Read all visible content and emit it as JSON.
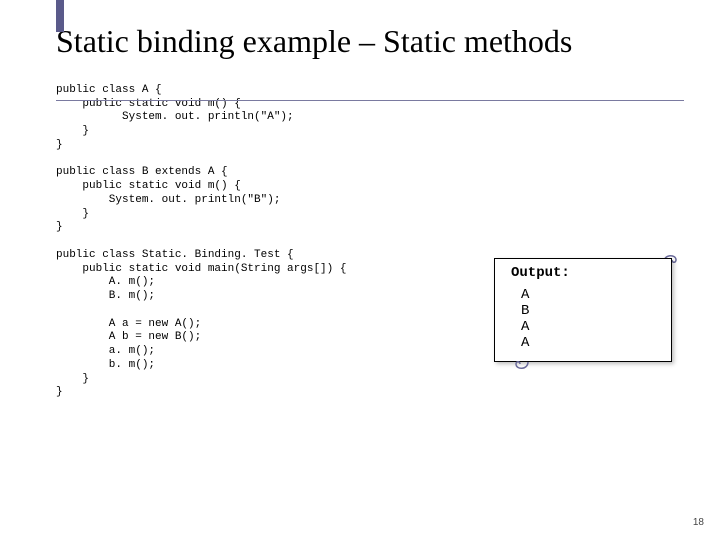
{
  "title": "Static binding example – Static methods",
  "code": "public class A {\n    public static void m() {\n          System. out. println(\"A\");\n    }\n}\n\npublic class B extends A {\n    public static void m() {\n        System. out. println(\"B\");\n    }\n}\n\npublic class Static. Binding. Test {\n    public static void main(String args[]) {\n        A. m();\n        B. m();\n\n        A a = new A();\n        A b = new B();\n        a. m();\n        b. m();\n    }\n}",
  "output": {
    "label": "Output:",
    "lines": "A\nB\nA\nA"
  },
  "page_number": "18"
}
